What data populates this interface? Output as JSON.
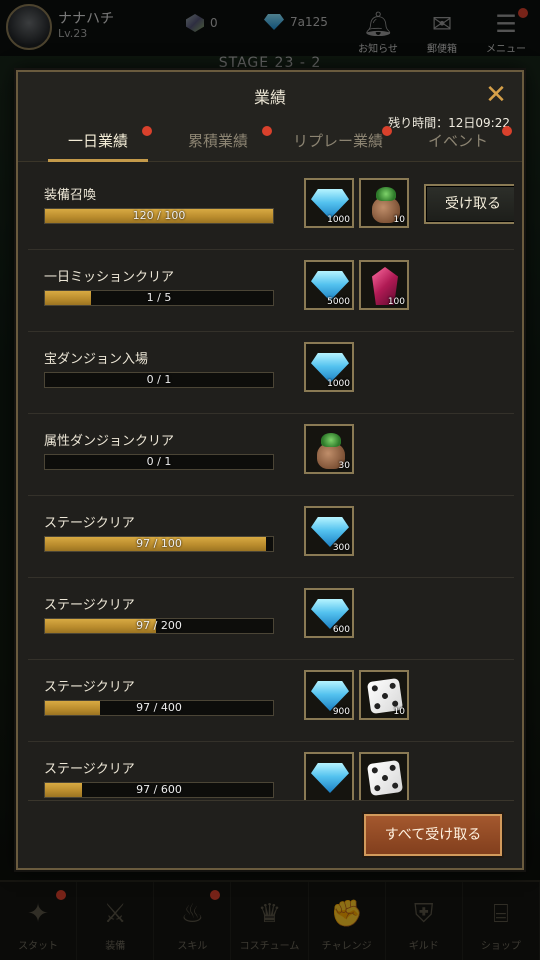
{
  "header": {
    "player_name": "ナナハチ",
    "player_level": "Lv.23",
    "currency_gem": "0",
    "currency_diamond": "7a125",
    "notice_label": "お知らせ",
    "mail_label": "郵便箱",
    "menu_label": "メニュー",
    "stage_label": "STAGE 23 - 2"
  },
  "modal": {
    "title": "業績",
    "timer": "残り時間：12日09:22",
    "tabs": [
      {
        "label": "一日業績",
        "active": true,
        "badge": true
      },
      {
        "label": "累積業績",
        "active": false,
        "badge": true
      },
      {
        "label": "リプレー業績",
        "active": false,
        "badge": true
      },
      {
        "label": "イベント",
        "active": false,
        "badge": true
      }
    ],
    "rows": [
      {
        "name": "装備召喚",
        "progress_text": "120 / 100",
        "progress": 1.0,
        "rewards": [
          {
            "icon": "diamond-icon",
            "qty": "1000"
          },
          {
            "icon": "seed-bag-icon",
            "qty": "10"
          }
        ],
        "claim": "受け取る"
      },
      {
        "name": "一日ミッションクリア",
        "progress_text": "1 / 5",
        "progress": 0.2,
        "rewards": [
          {
            "icon": "diamond-icon",
            "qty": "5000"
          },
          {
            "icon": "crystal-icon",
            "qty": "100"
          }
        ]
      },
      {
        "name": "宝ダンジョン入場",
        "progress_text": "0 / 1",
        "progress": 0,
        "rewards": [
          {
            "icon": "diamond-icon",
            "qty": "1000"
          }
        ]
      },
      {
        "name": "属性ダンジョンクリア",
        "progress_text": "0 / 1",
        "progress": 0,
        "rewards": [
          {
            "icon": "seed-bag-icon",
            "qty": "30"
          }
        ]
      },
      {
        "name": "ステージクリア",
        "progress_text": "97 / 100",
        "progress": 0.97,
        "rewards": [
          {
            "icon": "diamond-icon",
            "qty": "300"
          }
        ]
      },
      {
        "name": "ステージクリア",
        "progress_text": "97 / 200",
        "progress": 0.485,
        "rewards": [
          {
            "icon": "diamond-icon",
            "qty": "600"
          }
        ]
      },
      {
        "name": "ステージクリア",
        "progress_text": "97 / 400",
        "progress": 0.2425,
        "rewards": [
          {
            "icon": "diamond-icon",
            "qty": "900"
          },
          {
            "icon": "dice-icon",
            "qty": "10"
          }
        ]
      },
      {
        "name": "ステージクリア",
        "progress_text": "97 / 600",
        "progress": 0.1617,
        "rewards": [
          {
            "icon": "diamond-icon",
            "qty": ""
          },
          {
            "icon": "dice-icon",
            "qty": ""
          }
        ]
      }
    ],
    "claim_all": "すべて受け取る"
  },
  "nav": [
    {
      "label": "スタット",
      "icon": "stat-icon",
      "badge": true
    },
    {
      "label": "装備",
      "icon": "equipment-icon",
      "badge": false
    },
    {
      "label": "スキル",
      "icon": "skill-icon",
      "badge": true
    },
    {
      "label": "コスチューム",
      "icon": "costume-icon",
      "badge": false
    },
    {
      "label": "チャレンジ",
      "icon": "challenge-icon",
      "badge": false
    },
    {
      "label": "ギルド",
      "icon": "guild-icon",
      "badge": false
    },
    {
      "label": "ショップ",
      "icon": "shop-icon",
      "badge": false
    }
  ],
  "colors": {
    "accent_gold": "#c49a4a",
    "progress_gold": "#d8aa42",
    "badge_red": "#d9412c",
    "claim_all_bg": "#a4582e"
  }
}
